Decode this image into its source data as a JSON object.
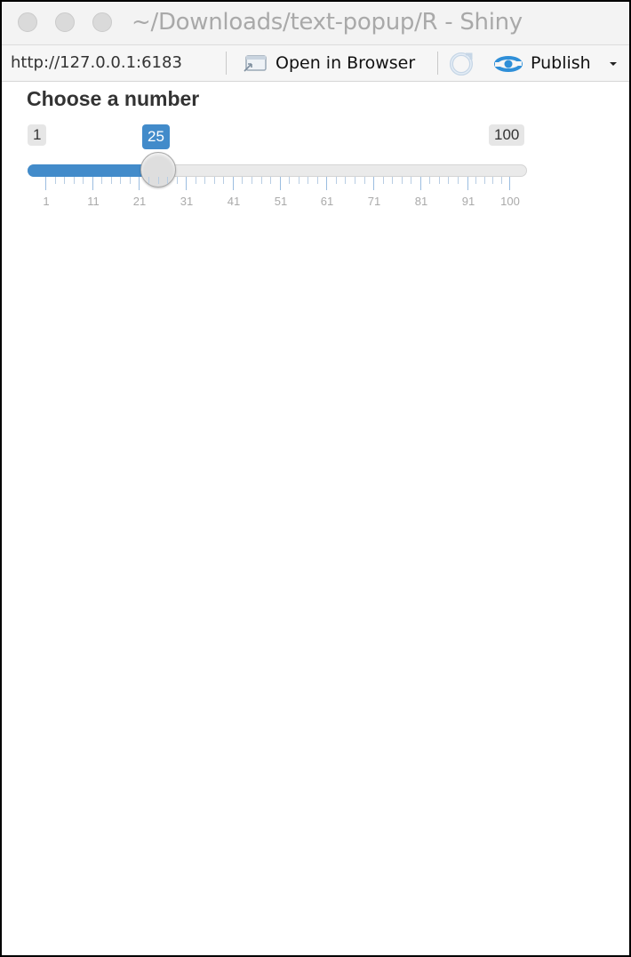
{
  "window": {
    "title": "~/Downloads/text-popup/R - Shiny"
  },
  "toolbar": {
    "url": "http://127.0.0.1:6183",
    "open_in_browser_label": "Open in Browser",
    "publish_label": "Publish"
  },
  "slider": {
    "label": "Choose a number",
    "min": 1,
    "max": 100,
    "value": 25,
    "min_label": "1",
    "max_label": "100",
    "value_label": "25",
    "tick_labels": [
      "1",
      "11",
      "21",
      "31",
      "41",
      "51",
      "61",
      "71",
      "81",
      "91",
      "100"
    ],
    "bar_color": "#428bca"
  }
}
